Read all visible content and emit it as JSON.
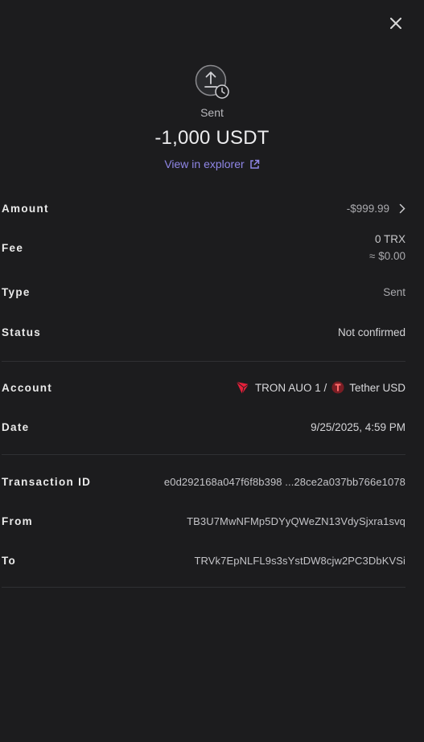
{
  "header": {
    "status_icon": "upload-clock-icon",
    "status_label": "Sent",
    "amount": "-1,000 USDT",
    "explorer_link": "View in explorer"
  },
  "close_icon": "close-icon",
  "details": {
    "amount_label": "Amount",
    "amount_value": "-$999.99",
    "fee_label": "Fee",
    "fee_value": "0 TRX",
    "fee_value_usd": "≈ $0.00",
    "type_label": "Type",
    "type_value": "Sent",
    "status_label": "Status",
    "status_value": "Not confirmed",
    "account_label": "Account",
    "account_name": "TRON AUO 1 /",
    "account_token": "Tether USD",
    "date_label": "Date",
    "date_value": "9/25/2025, 4:59 PM",
    "txid_label": "Transaction ID",
    "txid_value": "e0d292168a047f6f8b398 ...28ce2a037bb766e1078",
    "from_label": "From",
    "from_value": "TB3U7MwNFMp5DYyQWeZN13VdySjxra1svq",
    "to_label": "To",
    "to_value": "TRVk7EpNLFL9s3sYstDW8cjw2PC3DbKVSi"
  },
  "colors": {
    "background": "#1c1c1e",
    "accent_link": "#8f86e6",
    "tron_red": "#e5203a",
    "tether_badge": "#7a1d24"
  }
}
